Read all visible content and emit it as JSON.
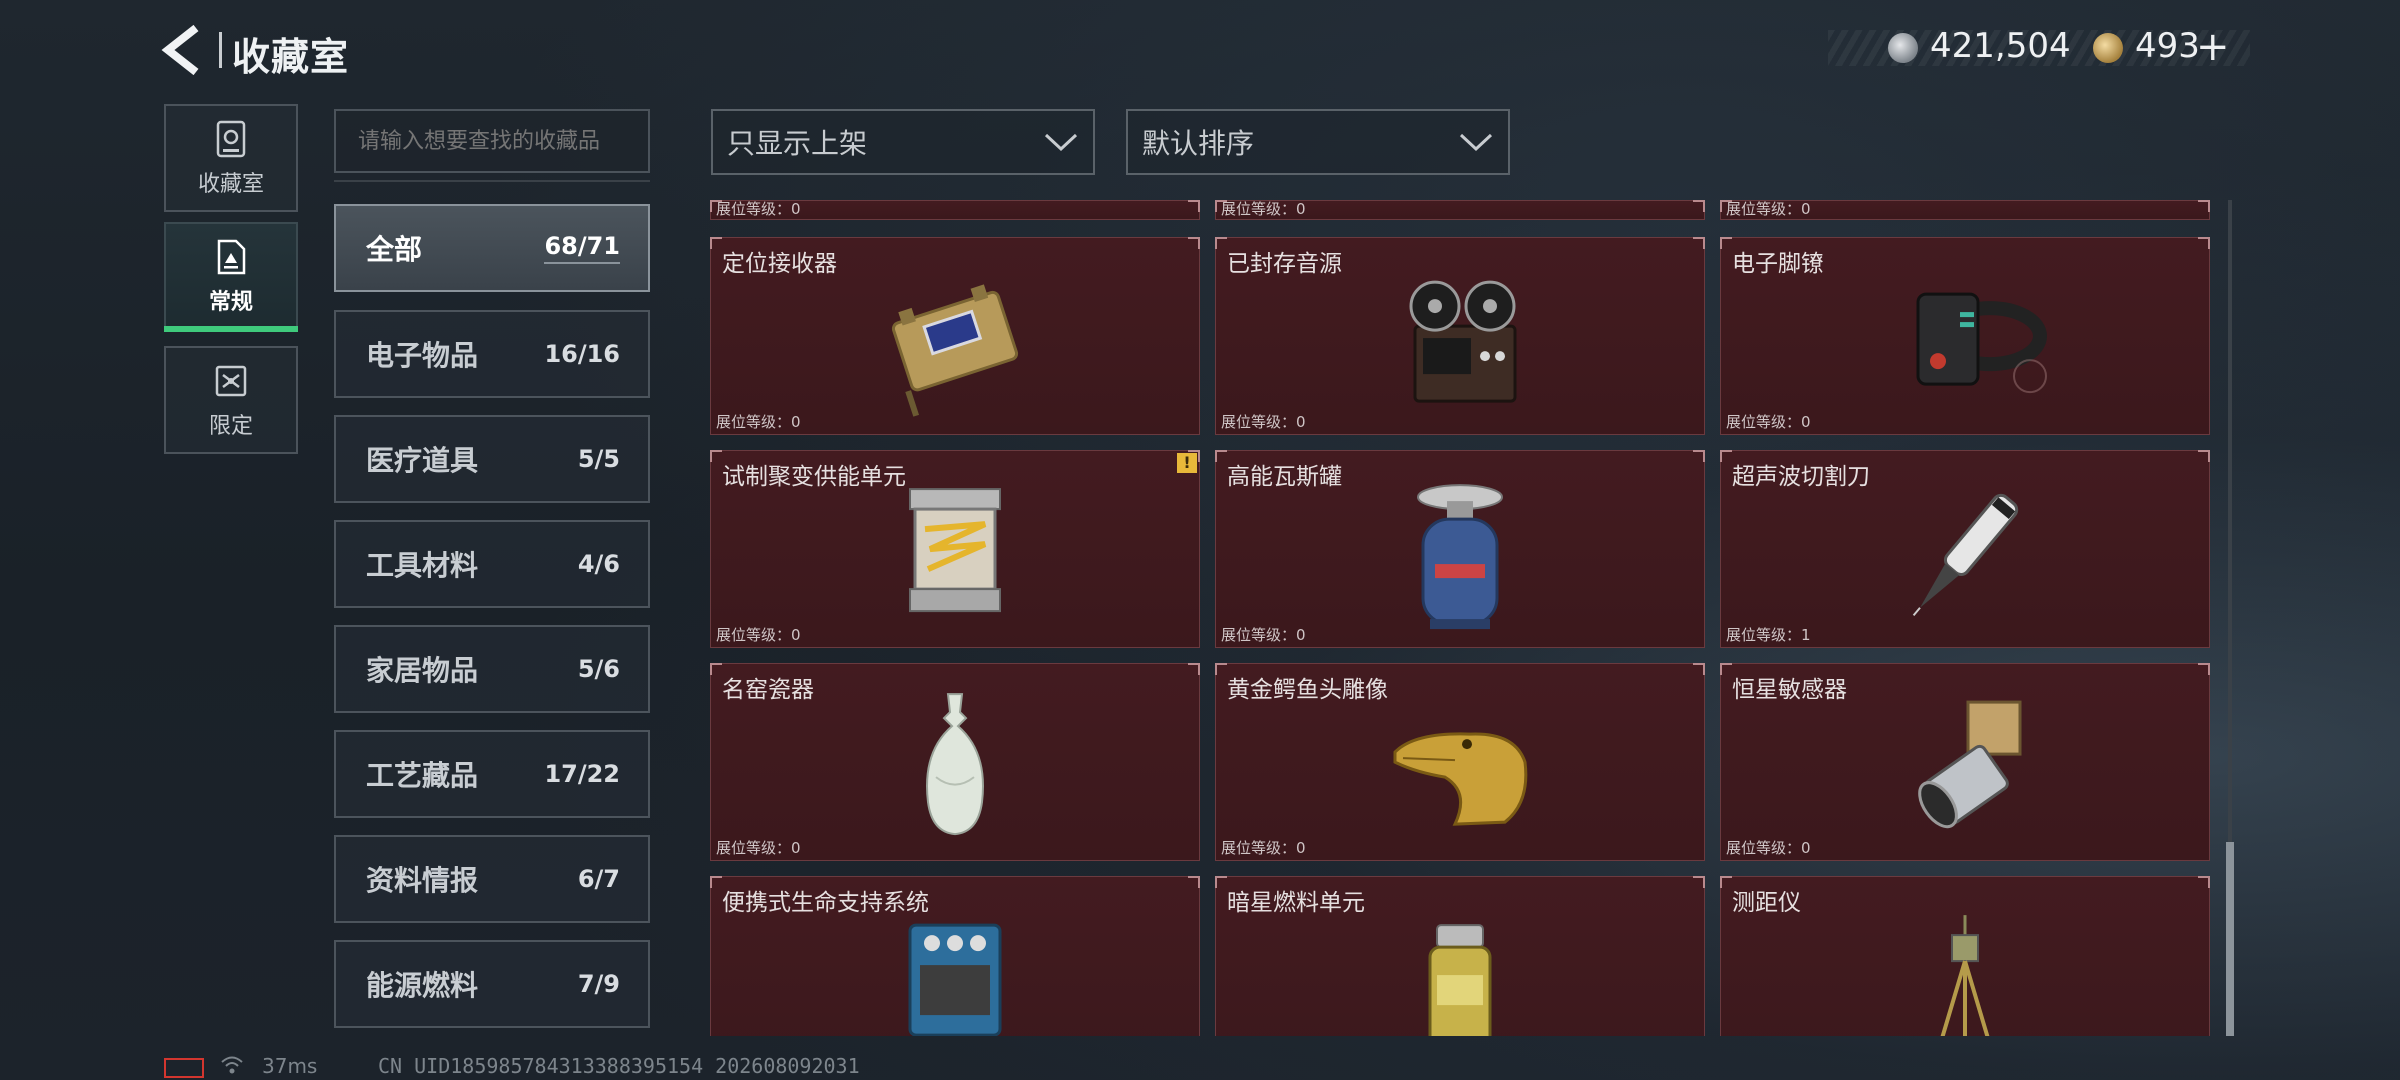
{
  "header": {
    "title": "收藏室",
    "currency": {
      "silver": "421,504",
      "gold": "493",
      "plus": "+"
    }
  },
  "nav": [
    {
      "label": "收藏室",
      "icon": "vault-icon"
    },
    {
      "label": "常规",
      "icon": "regular-icon"
    },
    {
      "label": "限定",
      "icon": "limited-icon"
    }
  ],
  "search": {
    "placeholder": "请输入想要查找的收藏品"
  },
  "categories": [
    {
      "name": "全部",
      "count": "68/71"
    },
    {
      "name": "电子物品",
      "count": "16/16"
    },
    {
      "name": "医疗道具",
      "count": "5/5"
    },
    {
      "name": "工具材料",
      "count": "4/6"
    },
    {
      "name": "家居物品",
      "count": "5/6"
    },
    {
      "name": "工艺藏品",
      "count": "17/22"
    },
    {
      "name": "资料情报",
      "count": "6/7"
    },
    {
      "name": "能源燃料",
      "count": "7/9"
    }
  ],
  "filters": {
    "show": "只显示上架",
    "sort": "默认排序"
  },
  "level_label": "展位等级：",
  "top_partial_levels": [
    "0",
    "0",
    "0"
  ],
  "items": [
    {
      "name": "定位接收器",
      "level": "0",
      "icon": "receiver-icon"
    },
    {
      "name": "已封存音源",
      "level": "0",
      "icon": "reel-recorder-icon"
    },
    {
      "name": "电子脚镣",
      "level": "0",
      "icon": "ankle-monitor-icon"
    },
    {
      "name": "试制聚变供能单元",
      "level": "0",
      "icon": "fusion-unit-icon",
      "flag": "!"
    },
    {
      "name": "高能瓦斯罐",
      "level": "0",
      "icon": "gas-canister-icon"
    },
    {
      "name": "超声波切割刀",
      "level": "1",
      "icon": "ultrasonic-knife-icon"
    },
    {
      "name": "名窑瓷器",
      "level": "0",
      "icon": "porcelain-vase-icon"
    },
    {
      "name": "黄金鳄鱼头雕像",
      "level": "0",
      "icon": "gold-crocodile-icon"
    },
    {
      "name": "恒星敏感器",
      "level": "0",
      "icon": "star-sensor-icon"
    },
    {
      "name": "便携式生命支持系统",
      "level": "",
      "icon": "life-support-icon"
    },
    {
      "name": "暗星燃料单元",
      "level": "",
      "icon": "fuel-cell-icon"
    },
    {
      "name": "测距仪",
      "level": "",
      "icon": "rangefinder-icon"
    }
  ],
  "footer": {
    "ping": "37ms",
    "uid": "CN UID185985784313388395154 202608092031"
  },
  "colors": {
    "accent_green": "#3fca7c",
    "card_bg": "#431b20",
    "flag_yellow": "#e8b83a"
  }
}
